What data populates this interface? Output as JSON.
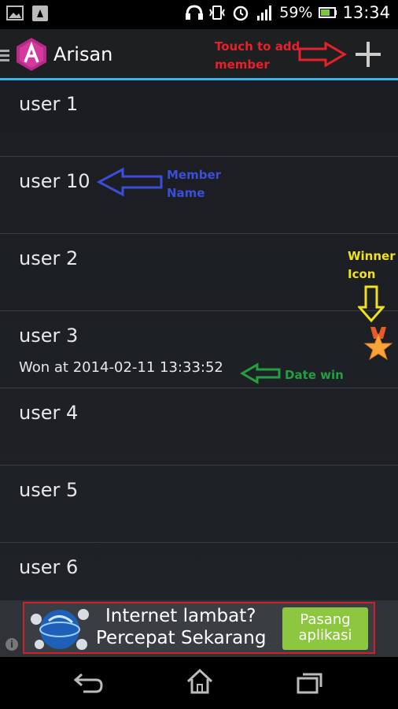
{
  "status_bar": {
    "battery_percent": "59%",
    "time": "13:34",
    "icons": [
      "picture-icon",
      "notification-icon",
      "headset-icon",
      "vibrate-icon",
      "alarm-icon",
      "signal-icon",
      "battery-icon"
    ]
  },
  "action_bar": {
    "title": "Arisan",
    "add_icon": "plus-icon",
    "menu_icon": "menu-icon"
  },
  "annotations": {
    "add_member_line1": "Touch to add",
    "add_member_line2": "member",
    "member_name_line1": "Member",
    "member_name_line2": "Name",
    "winner_icon_line1": "Winner",
    "winner_icon_line2": "Icon",
    "date_win": "Date win",
    "colors": {
      "add": "#e8202a",
      "member": "#3a4fd8",
      "winner": "#f0e020",
      "date": "#20a040"
    }
  },
  "members": [
    {
      "name": "user 1",
      "won": ""
    },
    {
      "name": "user 10",
      "won": ""
    },
    {
      "name": "user 2",
      "won": ""
    },
    {
      "name": "user 3",
      "won": "Won at 2014-02-11 13:33:52",
      "winner_icon": "medal-star-icon"
    },
    {
      "name": "user 4",
      "won": ""
    },
    {
      "name": "user 5",
      "won": ""
    },
    {
      "name": "user 6",
      "won": ""
    }
  ],
  "ad": {
    "line1": "Internet lambat?",
    "line2": "Percepat Sekarang",
    "button_line1": "Pasang",
    "button_line2": "aplikasi",
    "info": "i",
    "accent": "#8dc63f"
  },
  "nav_bar": {
    "icons": [
      "back-icon",
      "home-icon",
      "recent-apps-icon"
    ]
  }
}
